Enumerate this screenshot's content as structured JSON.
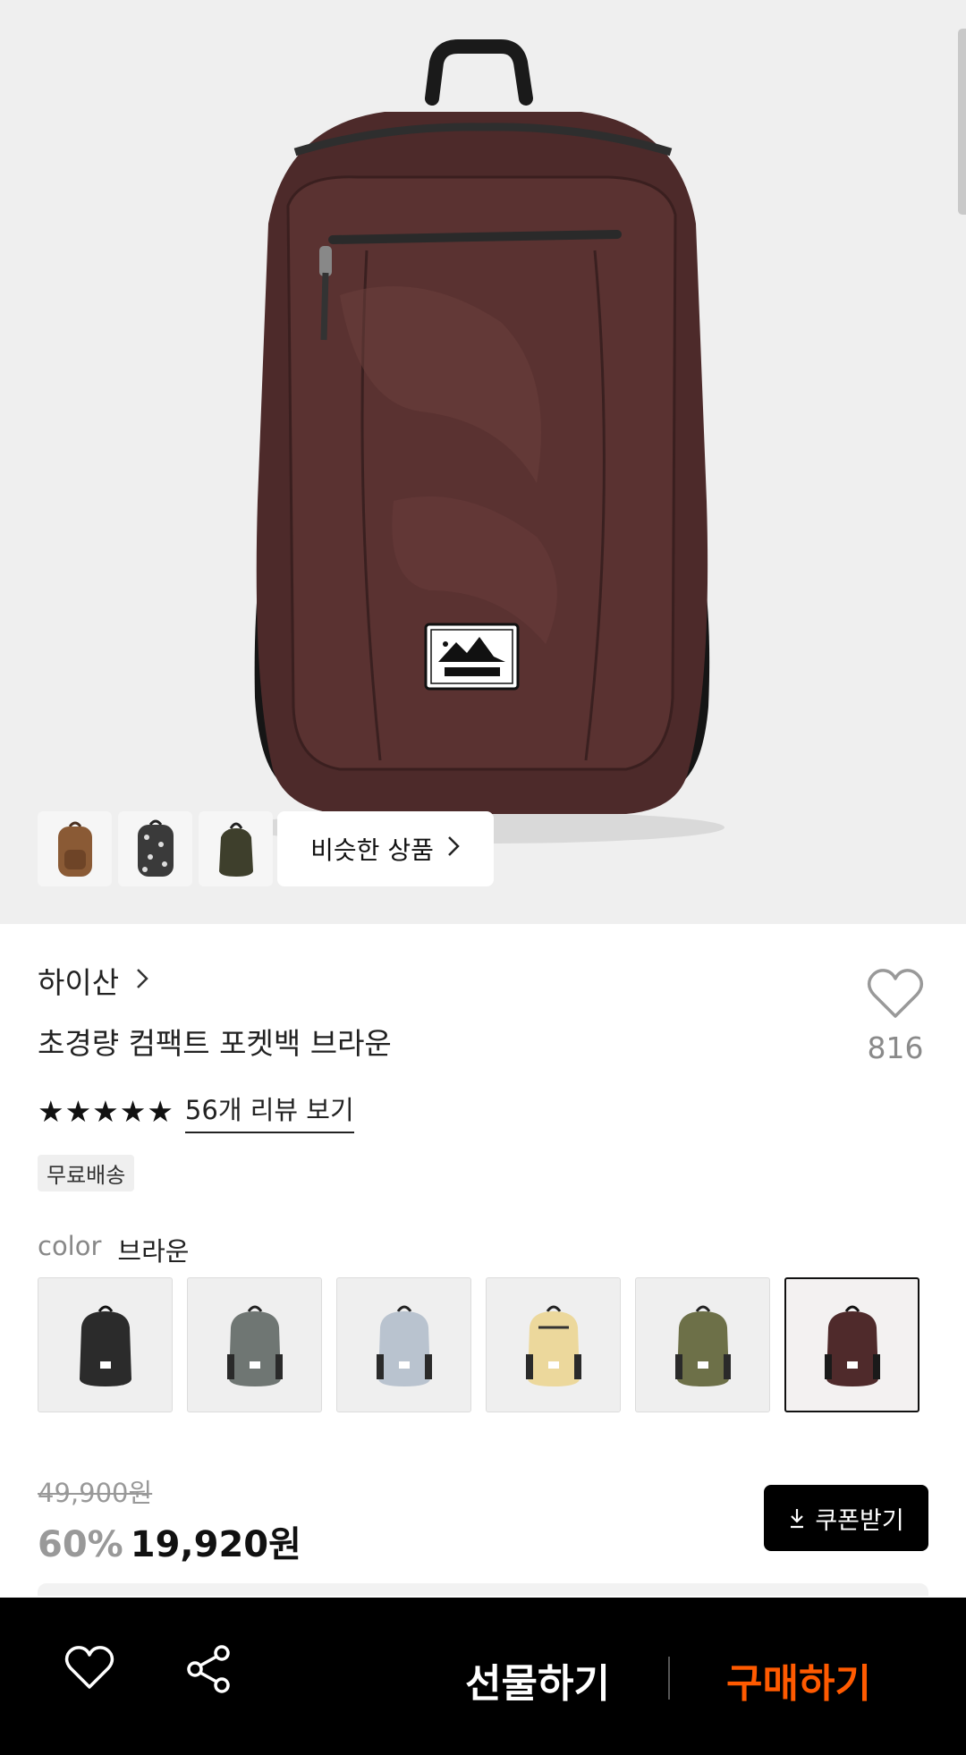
{
  "hero": {
    "similar_label": "비슷한 상품",
    "similar_icon": "chevron-right-icon",
    "thumbnails": [
      {
        "name": "thumb-brown-backpack",
        "color": "#8a5a35"
      },
      {
        "name": "thumb-patterned-backpack",
        "color": "#3a3a3a"
      },
      {
        "name": "thumb-olive-backpack",
        "color": "#3e3f2c"
      }
    ]
  },
  "product": {
    "brand": "하이산",
    "name": "초경량 컴팩트 포켓백 브라운",
    "like_count": "816",
    "rating_stars": "★★★★★",
    "review_link": "56개 리뷰 보기",
    "badge": "무료배송",
    "color_label": "color",
    "color_value": "브라운",
    "swatches": [
      {
        "name": "black",
        "color": "#2b2b2b"
      },
      {
        "name": "gray",
        "color": "#6f7673"
      },
      {
        "name": "sky",
        "color": "#b9c3cf"
      },
      {
        "name": "yellow",
        "color": "#ecd89c"
      },
      {
        "name": "khaki",
        "color": "#6d7048"
      },
      {
        "name": "brown",
        "color": "#4f2a2b",
        "selected": true
      }
    ]
  },
  "price": {
    "original": "49,900원",
    "discount": "60%",
    "sale": "19,920원",
    "coupon_label": "쿠폰받기",
    "coupon_icon": "download-icon"
  },
  "bottom_bar": {
    "heart_icon": "heart-outline-icon",
    "share_icon": "share-icon",
    "gift_label": "선물하기",
    "buy_label": "구매하기",
    "buy_color": "#ff5a00"
  }
}
